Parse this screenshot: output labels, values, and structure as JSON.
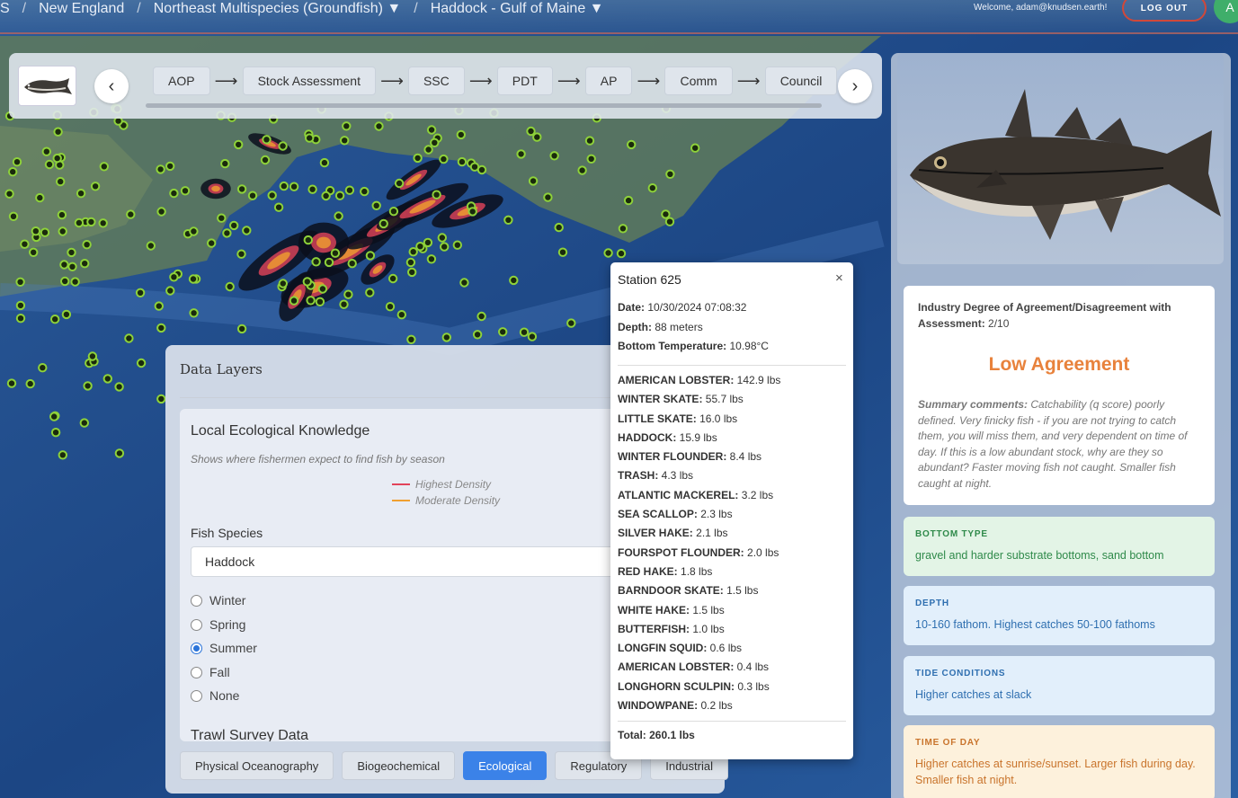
{
  "breadcrumb": {
    "root": "S",
    "sep": "/",
    "region": "New England",
    "plan": "Northeast Multispecies (Groundfish) ▼",
    "stock": "Haddock - Gulf of Maine ▼"
  },
  "header": {
    "welcome": "Welcome, adam@knudsen.earth!",
    "logout_label": "LOG OUT",
    "avatar_letter": "A"
  },
  "workflow": {
    "steps": [
      "AOP",
      "Stock Assessment",
      "SSC",
      "PDT",
      "AP",
      "Comm",
      "Council"
    ],
    "arrow": "⟶",
    "prev_icon": "‹",
    "next_icon": "›"
  },
  "data_layers": {
    "title": "Data Layers",
    "lek": {
      "title": "Local Ecological Knowledge",
      "subtitle": "Shows where fishermen expect to find fish by season",
      "legend": [
        {
          "label": "Highest Density",
          "color": "#e2435a"
        },
        {
          "label": "Moderate Density",
          "color": "#f0a030"
        }
      ],
      "species_label": "Fish Species",
      "species_value": "Haddock",
      "seasons": [
        "Winter",
        "Spring",
        "Summer",
        "Fall",
        "None"
      ],
      "selected_season": "Summer"
    },
    "trawl_title": "Trawl Survey Data",
    "tabs": [
      "Physical Oceanography",
      "Biogeochemical",
      "Ecological",
      "Regulatory",
      "Industrial"
    ],
    "active_tab": "Ecological"
  },
  "station_popup": {
    "title": "Station 625",
    "close": "×",
    "date_label": "Date:",
    "date": "10/30/2024 07:08:32",
    "depth_label": "Depth:",
    "depth": "88 meters",
    "temp_label": "Bottom Temperature:",
    "temp": "10.98°C",
    "catches": [
      {
        "species": "AMERICAN LOBSTER:",
        "amount": "142.9 lbs"
      },
      {
        "species": "WINTER SKATE:",
        "amount": "55.7 lbs"
      },
      {
        "species": "LITTLE SKATE:",
        "amount": "16.0 lbs"
      },
      {
        "species": "HADDOCK:",
        "amount": "15.9 lbs"
      },
      {
        "species": "WINTER FLOUNDER:",
        "amount": "8.4 lbs"
      },
      {
        "species": "TRASH:",
        "amount": "4.3 lbs"
      },
      {
        "species": "ATLANTIC MACKEREL:",
        "amount": "3.2 lbs"
      },
      {
        "species": "SEA SCALLOP:",
        "amount": "2.3 lbs"
      },
      {
        "species": "SILVER HAKE:",
        "amount": "2.1 lbs"
      },
      {
        "species": "FOURSPOT FLOUNDER:",
        "amount": "2.0 lbs"
      },
      {
        "species": "RED HAKE:",
        "amount": "1.8 lbs"
      },
      {
        "species": "BARNDOOR SKATE:",
        "amount": "1.5 lbs"
      },
      {
        "species": "WHITE HAKE:",
        "amount": "1.5 lbs"
      },
      {
        "species": "BUTTERFISH:",
        "amount": "1.0 lbs"
      },
      {
        "species": "LONGFIN SQUID:",
        "amount": "0.6 lbs"
      },
      {
        "species": "AMERICAN LOBSTER:",
        "amount": "0.4 lbs"
      },
      {
        "species": "LONGHORN SCULPIN:",
        "amount": "0.3 lbs"
      },
      {
        "species": "WINDOWPANE:",
        "amount": "0.2 lbs"
      }
    ],
    "total_label": "Total:",
    "total": "260.1 lbs"
  },
  "assessment": {
    "heading": "Industry Degree of Agreement/Disagreement with Assessment:",
    "score": "2/10",
    "result": "Low Agreement",
    "summary_label": "Summary comments:",
    "summary": "Catchability (q score) poorly defined. Very finicky fish - if you are not trying to catch them, you will miss them, and very dependent on time of day. If this is a low abundant stock, why are they so abundant? Faster moving fish not caught. Smaller fish caught at night."
  },
  "info_cards": [
    {
      "label": "BOTTOM TYPE",
      "value": "gravel and harder substrate bottoms, sand bottom",
      "bg": "#e3f4e6",
      "label_color": "#2f8a4a",
      "value_color": "#2f8a4a"
    },
    {
      "label": "DEPTH",
      "value": "10-160 fathom. Highest catches 50-100 fathoms",
      "bg": "#e2effb",
      "label_color": "#2f6fb0",
      "value_color": "#2f6fb0"
    },
    {
      "label": "TIDE CONDITIONS",
      "value": "Higher catches at slack",
      "bg": "#e2effb",
      "label_color": "#2f6fb0",
      "value_color": "#2f6fb0"
    },
    {
      "label": "TIME OF DAY",
      "value": "Higher catches at sunrise/sunset. Larger fish during day. Smaller fish at night.",
      "bg": "#fdf1dc",
      "label_color": "#c9742c",
      "value_color": "#c9742c"
    }
  ]
}
